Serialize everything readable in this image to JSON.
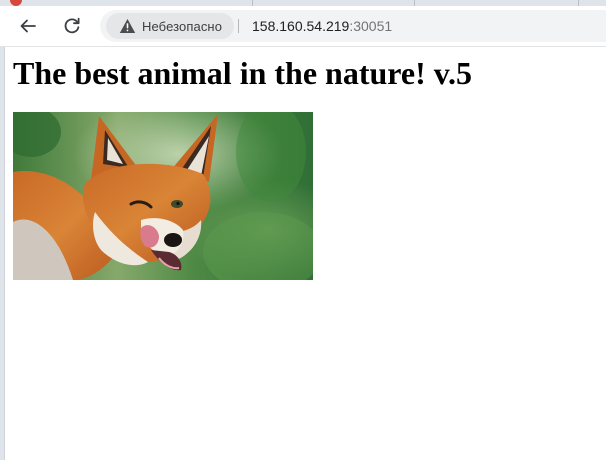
{
  "browser": {
    "security_chip_label": "Небезопасно",
    "url_host": "158.160.54.219",
    "url_port": ":30051"
  },
  "page": {
    "heading": "The best animal in the nature! v.5",
    "image": {
      "subject": "red fox licking its nose",
      "icon": "fox-photo"
    }
  },
  "colors": {
    "toolbar_bg": "#ffffff",
    "tabstrip_bg": "#dfe3ea",
    "omnibox_bg": "#f1f3f4",
    "chip_bg": "#e4e6e8",
    "url_text": "#202124",
    "port_text": "#70757a"
  }
}
